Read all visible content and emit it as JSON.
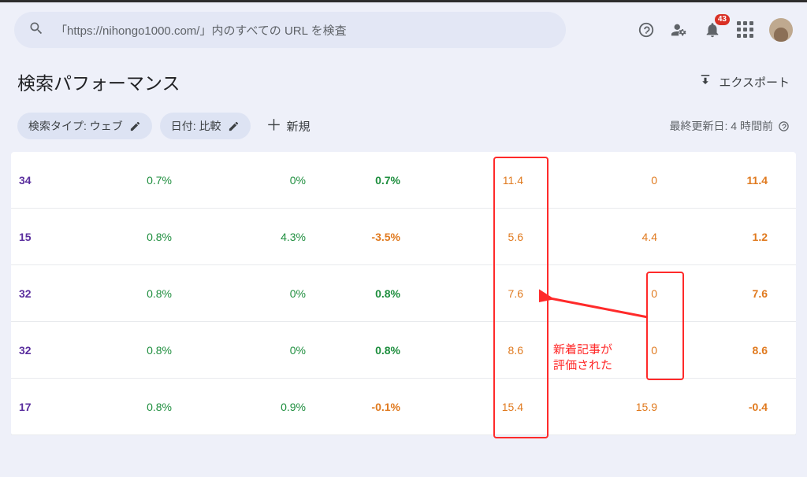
{
  "header": {
    "search_text": "「https://nihongo1000.com/」内のすべての URL を検査",
    "notification_count": "43"
  },
  "page": {
    "title": "検索パフォーマンス",
    "export_label": "エクスポート"
  },
  "chips": {
    "search_type": "検索タイプ: ウェブ",
    "date": "日付: 比較",
    "add_new": "新規"
  },
  "meta": {
    "last_updated": "最終更新日: 4 時間前"
  },
  "rows": [
    {
      "c0": "34",
      "c1": "0.7%",
      "c2": "0%",
      "c3": "0.7%",
      "c3c": "green",
      "c4": "11.4",
      "c5": "0",
      "c6": "11.4",
      "c6c": "orange"
    },
    {
      "c0": "15",
      "c1": "0.8%",
      "c2": "4.3%",
      "c3": "-3.5%",
      "c3c": "orange",
      "c4": "5.6",
      "c5": "4.4",
      "c6": "1.2",
      "c6c": "orange"
    },
    {
      "c0": "32",
      "c1": "0.8%",
      "c2": "0%",
      "c3": "0.8%",
      "c3c": "green",
      "c4": "7.6",
      "c5": "0",
      "c6": "7.6",
      "c6c": "orange"
    },
    {
      "c0": "32",
      "c1": "0.8%",
      "c2": "0%",
      "c3": "0.8%",
      "c3c": "green",
      "c4": "8.6",
      "c5": "0",
      "c6": "8.6",
      "c6c": "orange"
    },
    {
      "c0": "17",
      "c1": "0.8%",
      "c2": "0.9%",
      "c3": "-0.1%",
      "c3c": "orange",
      "c4": "15.4",
      "c5": "15.9",
      "c6": "-0.4",
      "c6c": "orange"
    }
  ],
  "annotation": {
    "text_line1": "新着記事が",
    "text_line2": "評価された"
  }
}
